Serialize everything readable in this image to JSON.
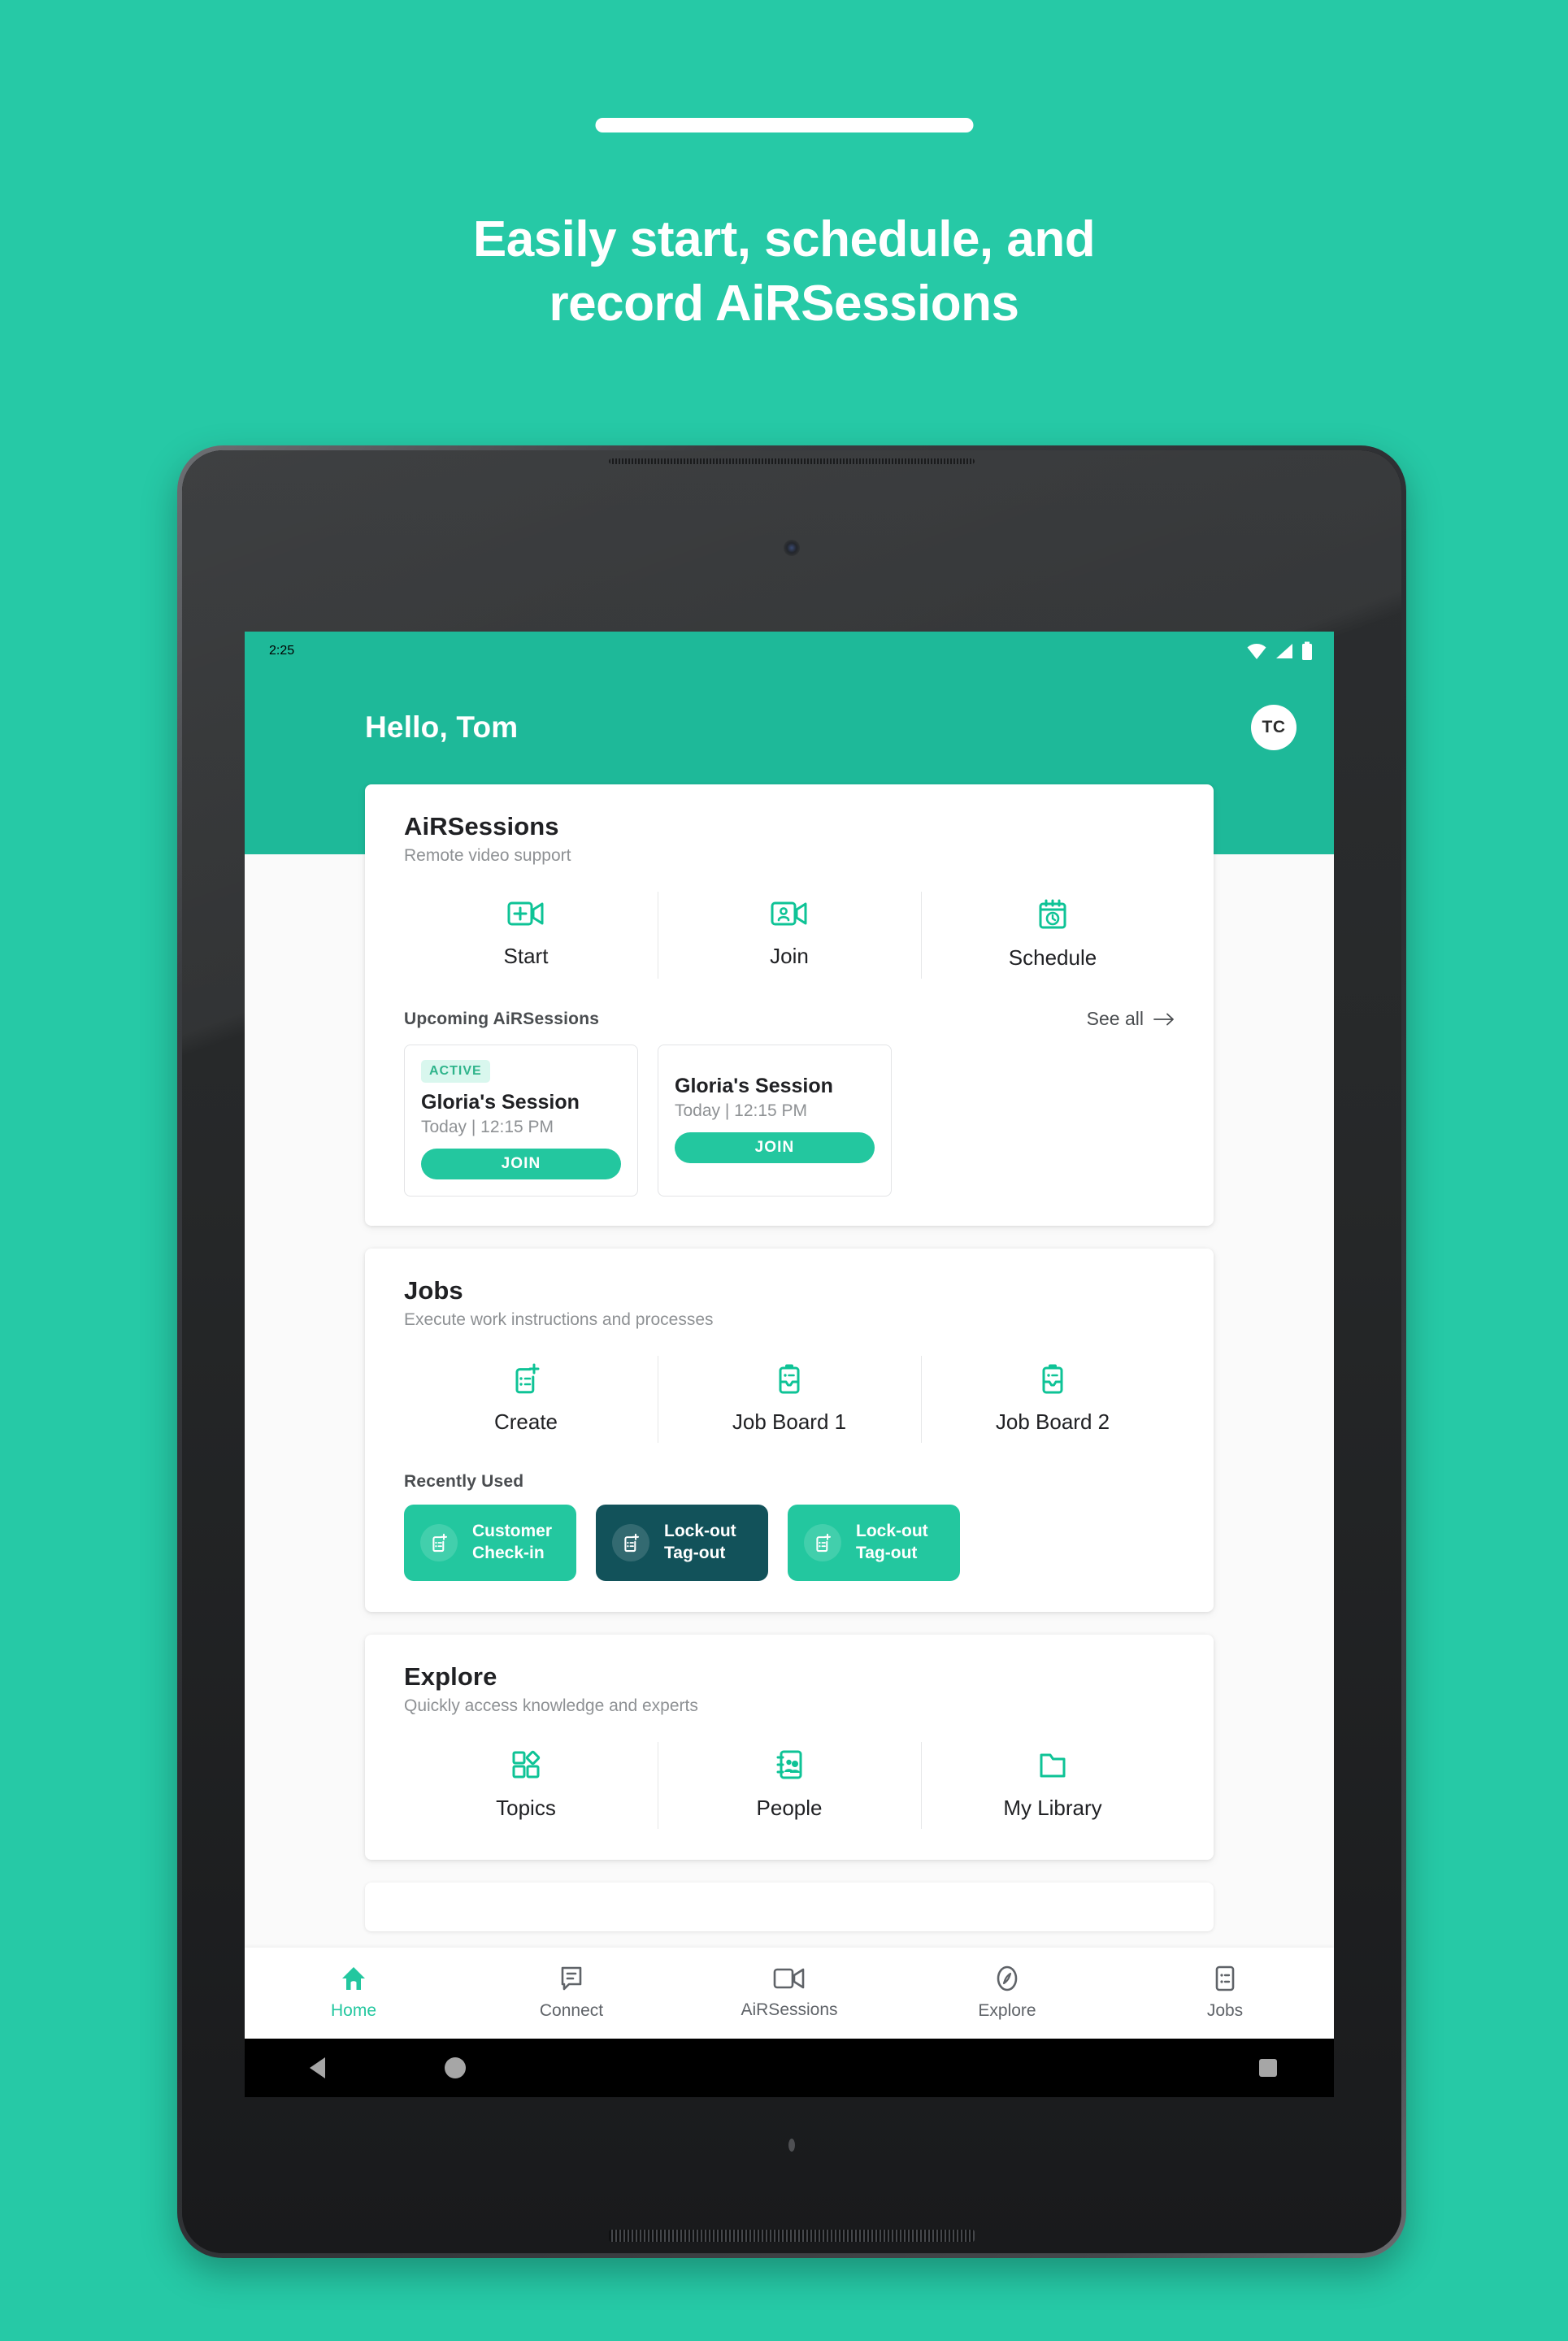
{
  "promo": {
    "title_line1": "Easily start, schedule, and",
    "title_line2": "record AiRSessions",
    "background_color": "#26c9a6",
    "pill": "drag-pill"
  },
  "theme": {
    "brand": "#1eb999",
    "accent": "#23c79f",
    "dark_chip": "#12525a",
    "badge_bg": "#d9f7ee",
    "badge_text": "#2fb48b",
    "screen_bg": "#fafafa"
  },
  "statusbar": {
    "time": "2:25",
    "icons": [
      "wifi-icon",
      "signal-icon",
      "battery-icon"
    ]
  },
  "appbar": {
    "greeting": "Hello, Tom",
    "avatar_initials": "TC"
  },
  "cards": {
    "airsessions": {
      "title": "AiRSessions",
      "subtitle": "Remote video support",
      "actions": [
        {
          "label": "Start",
          "icon": "video-add-icon"
        },
        {
          "label": "Join",
          "icon": "video-person-icon"
        },
        {
          "label": "Schedule",
          "icon": "calendar-clock-icon"
        }
      ],
      "section_label": "Upcoming AiRSessions",
      "see_all": "See all",
      "sessions": [
        {
          "badge": "ACTIVE",
          "name": "Gloria's Session",
          "time": "Today | 12:15 PM",
          "join_label": "JOIN"
        },
        {
          "badge": "",
          "name": "Gloria's Session",
          "time": "Today | 12:15 PM",
          "join_label": "JOIN"
        }
      ]
    },
    "jobs": {
      "title": "Jobs",
      "subtitle": "Execute work instructions and processes",
      "actions": [
        {
          "label": "Create",
          "icon": "job-add-icon"
        },
        {
          "label": "Job Board 1",
          "icon": "job-board-icon"
        },
        {
          "label": "Job Board 2",
          "icon": "job-board-icon"
        }
      ],
      "section_label": "Recently Used",
      "chips": [
        {
          "line1": "Customer",
          "line2": "Check-in",
          "style": "green",
          "icon": "job-add-icon"
        },
        {
          "line1": "Lock-out",
          "line2": "Tag-out",
          "style": "dark",
          "icon": "job-add-icon"
        },
        {
          "line1": "Lock-out",
          "line2": "Tag-out",
          "style": "green",
          "icon": "job-add-icon"
        }
      ]
    },
    "explore": {
      "title": "Explore",
      "subtitle": "Quickly access knowledge and experts",
      "actions": [
        {
          "label": "Topics",
          "icon": "shapes-icon"
        },
        {
          "label": "People",
          "icon": "contacts-icon"
        },
        {
          "label": "My Library",
          "icon": "folder-icon"
        }
      ]
    }
  },
  "bottomnav": {
    "items": [
      {
        "label": "Home",
        "icon": "home-icon",
        "active": true
      },
      {
        "label": "Connect",
        "icon": "chat-icon",
        "active": false
      },
      {
        "label": "AiRSessions",
        "icon": "video-icon",
        "active": false
      },
      {
        "label": "Explore",
        "icon": "compass-icon",
        "active": false
      },
      {
        "label": "Jobs",
        "icon": "list-icon",
        "active": false
      }
    ]
  },
  "sysnav": {
    "back": "back-button",
    "home": "home-button",
    "recents": "recents-button"
  }
}
